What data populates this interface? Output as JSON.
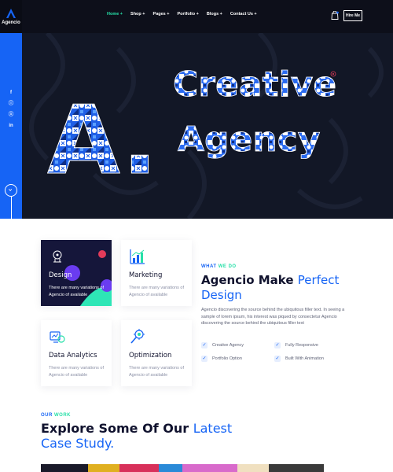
{
  "brand": {
    "name": "Agencio"
  },
  "nav": {
    "items": [
      {
        "label": "Home +",
        "active": true
      },
      {
        "label": "Shop +",
        "active": false
      },
      {
        "label": "Pages +",
        "active": false
      },
      {
        "label": "Portfolio +",
        "active": false
      },
      {
        "label": "Blogs +",
        "active": false
      },
      {
        "label": "Contact Us +",
        "active": false
      }
    ],
    "hire_label": "Hire Me",
    "cart_icon": "shopping-bag-icon"
  },
  "hero": {
    "letter": "A.",
    "line1": "Creative",
    "line2": "Agency",
    "social": [
      "f",
      "ⓘ",
      "ⓢ",
      "in"
    ],
    "social_icons": [
      "facebook-icon",
      "instagram-icon",
      "skype-icon",
      "linkedin-icon"
    ]
  },
  "services": [
    {
      "title": "Design",
      "desc": "There are many variations of Agencio of available",
      "icon": "design-icon"
    },
    {
      "title": "Marketing",
      "desc": "There are many variations of Agencio of available",
      "icon": "chart-icon"
    },
    {
      "title": "Data Analytics",
      "desc": "There are many variations of Agencio of available",
      "icon": "data-analytics-icon"
    },
    {
      "title": "Optimization",
      "desc": "There are many variations of Agencio of available",
      "icon": "optimization-icon"
    }
  ],
  "about": {
    "eyebrow_a": "WHAT",
    "eyebrow_b": "WE DO",
    "heading_a": "Agencio Make",
    "heading_b": "Perfect",
    "heading_c": "Design",
    "paragraph": "Agencio discovering the source behind the ubiquitous filler text. In seeing a sample of lorem ipsum, his interest was piqued by consectetur Agencio discovering the source behind the ubiquitous filler text",
    "features": [
      "Creative Agency",
      "Fully Responsive",
      "Portfolio Option",
      "Built With Animation"
    ]
  },
  "work": {
    "eyebrow_a": "OUR",
    "eyebrow_b": "WORK",
    "heading_a": "Explore Some Of Our",
    "heading_b": "Latest",
    "heading_c": "Case Study."
  },
  "colors": {
    "primary": "#1664f5",
    "accent": "#26e0a8",
    "dark": "#10122e"
  }
}
